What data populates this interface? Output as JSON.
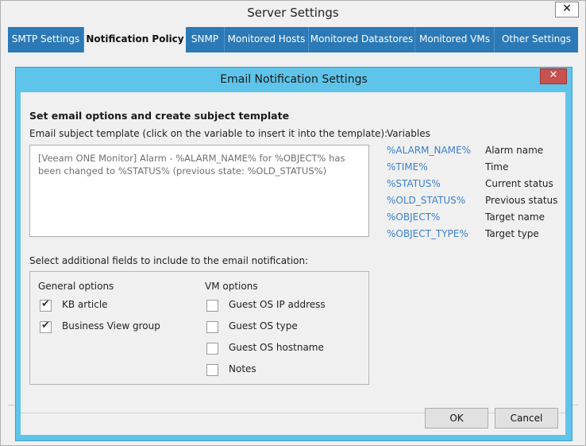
{
  "window": {
    "title": "Server Settings",
    "close_glyph": "✕"
  },
  "tabs": [
    {
      "label": "SMTP Settings",
      "active": false
    },
    {
      "label": "Notification Policy",
      "active": true
    },
    {
      "label": "SNMP",
      "active": false
    },
    {
      "label": "Monitored Hosts",
      "active": false
    },
    {
      "label": "Monitored Datastores",
      "active": false
    },
    {
      "label": "Monitored VMs",
      "active": false
    },
    {
      "label": "Other Settings",
      "active": false
    }
  ],
  "dialog": {
    "title": "Email Notification Settings",
    "close_glyph": "✕",
    "heading": "Set email options and create subject template",
    "subject_label": "Email subject template (click on the variable to insert it into the template):",
    "subject_value": "[Veeam ONE Monitor] Alarm - %ALARM_NAME% for %OBJECT% has been changed to %STATUS% (previous state: %OLD_STATUS%)",
    "variables_label": "Variables",
    "variables": [
      {
        "name": "%ALARM_NAME%",
        "desc": "Alarm name"
      },
      {
        "name": "%TIME%",
        "desc": "Time"
      },
      {
        "name": "%STATUS%",
        "desc": "Current status"
      },
      {
        "name": "%OLD_STATUS%",
        "desc": "Previous status"
      },
      {
        "name": "%OBJECT%",
        "desc": "Target name"
      },
      {
        "name": "%OBJECT_TYPE%",
        "desc": "Target type"
      }
    ],
    "fields_label": "Select additional fields to include to the email notification:",
    "general": {
      "label": "General options",
      "options": [
        {
          "label": "KB article",
          "checked": true
        },
        {
          "label": "Business View group",
          "checked": true
        }
      ]
    },
    "vm": {
      "label": "VM options",
      "options": [
        {
          "label": "Guest OS IP address",
          "checked": false
        },
        {
          "label": "Guest OS type",
          "checked": false
        },
        {
          "label": "Guest OS hostname",
          "checked": false
        },
        {
          "label": "Notes",
          "checked": false
        }
      ]
    },
    "ok_label": "OK",
    "cancel_label": "Cancel"
  },
  "colors": {
    "accent_tab_bar": "#2b79b6",
    "dialog_frame": "#5fc4ea",
    "close_button": "#c75050",
    "variable_link": "#3a7fd0"
  },
  "icons": {
    "check": "checkmark-icon",
    "close": "close-icon"
  }
}
